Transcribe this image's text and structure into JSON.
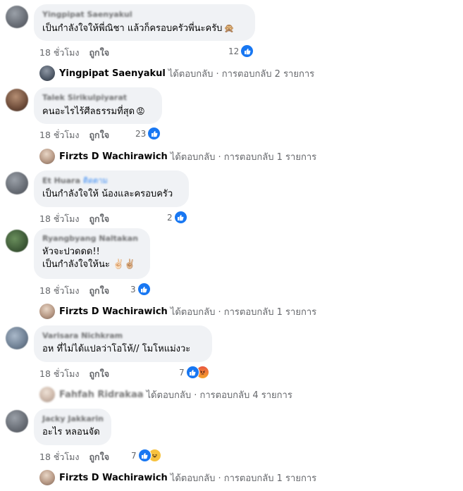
{
  "comments": [
    {
      "author": "Yingpipat Saenyakul",
      "text": "เป็นกำลังใจให้พี่ณิชา แล้วก็ครอบครัวพี่นะครับ",
      "time": "18 ชั่วโมง",
      "like_label": "ถูกใจ",
      "reactions": "12",
      "reply": {
        "name": "Yingpipat Saenyakul",
        "text": "ได้ตอบกลับ · การตอบกลับ 2 รายการ"
      }
    },
    {
      "author": "Talek Sirikulpiyarat",
      "text": "คนอะไรไร้ศีลธรรมที่สุด",
      "time": "18 ชั่วโมง",
      "like_label": "ถูกใจ",
      "reactions": "23",
      "reply": {
        "name": "Firzts D Wachirawich",
        "text": "ได้ตอบกลับ · การตอบกลับ 1 รายการ"
      }
    },
    {
      "author": "Et Huara",
      "follow_tag": "ติดตาม",
      "text": "เป็นกำลังใจให้ น้องและครอบครัว",
      "time": "18 ชั่วโมง",
      "like_label": "ถูกใจ",
      "reactions": "2"
    },
    {
      "author": "Ryangbyang Naltakan",
      "text_line1": "หัวจะปวดดด!!",
      "text_line2": "เป็นกำลังใจให้นะ ✌🏻✌🏼",
      "time": "18 ชั่วโมง",
      "like_label": "ถูกใจ",
      "reactions": "3",
      "reply": {
        "name": "Firzts D Wachirawich",
        "text": "ได้ตอบกลับ · การตอบกลับ 1 รายการ"
      }
    },
    {
      "author": "Varisara Nichkram",
      "text": "อห ที่ไม่ได้แปลว่าโอโห้// โมโหแม่งวะ",
      "time": "18 ชั่วโมง",
      "like_label": "ถูกใจ",
      "reactions": "7",
      "reply": {
        "name": "Fahfah Ridrakaa",
        "text": "ได้ตอบกลับ · การตอบกลับ 4 รายการ"
      }
    },
    {
      "author": "Jacky Jakkarin",
      "text": "อะไร หลอนจัด",
      "time": "18 ชั่วโมง",
      "like_label": "ถูกใจ",
      "reactions": "7",
      "reply": {
        "name": "Firzts D Wachirawich",
        "text": "ได้ตอบกลับ · การตอบกลับ 1 รายการ"
      }
    }
  ],
  "icons": {
    "like": "like-icon",
    "angry": "angry-icon",
    "haha": "haha-icon",
    "monkey": "monkey-emoji",
    "angry_face": "angry-face-emoji"
  },
  "colors": {
    "bubble": "#f0f2f5",
    "like_blue": "#1877f2",
    "meta_gray": "#65676b"
  }
}
